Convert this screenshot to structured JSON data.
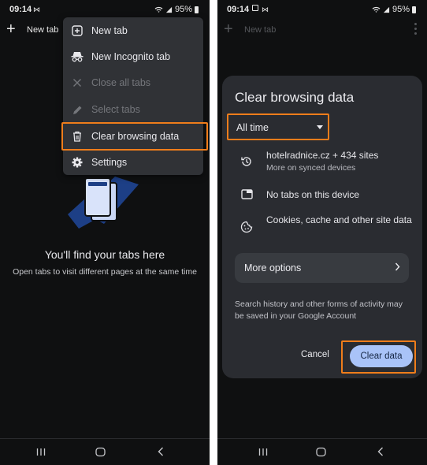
{
  "left_screen": {
    "status_bar": {
      "time": "09:14",
      "battery": "95%"
    },
    "toolbar": {
      "new_tab_label": "New tab"
    },
    "menu": {
      "items": [
        {
          "label": "New tab",
          "icon": "plus-box-icon",
          "enabled": true
        },
        {
          "label": "New Incognito tab",
          "icon": "incognito-icon",
          "enabled": true
        },
        {
          "label": "Close all tabs",
          "icon": "close-icon",
          "enabled": false
        },
        {
          "label": "Select tabs",
          "icon": "pencil-icon",
          "enabled": false
        },
        {
          "label": "Clear browsing data",
          "icon": "trash-icon",
          "enabled": true,
          "highlighted": true
        },
        {
          "label": "Settings",
          "icon": "gear-icon",
          "enabled": true
        }
      ]
    },
    "empty_state": {
      "title": "You'll find your tabs here",
      "subtitle": "Open tabs to visit different pages at the same time"
    }
  },
  "right_screen": {
    "status_bar": {
      "time": "09:14",
      "battery": "95%"
    },
    "toolbar": {
      "new_tab_label": "New tab"
    },
    "dialog": {
      "title": "Clear browsing data",
      "time_range": {
        "selected": "All time",
        "highlighted": true
      },
      "rows": [
        {
          "icon": "history-icon",
          "text": "hotelradnice.cz + 434 sites",
          "sub": "More on synced devices"
        },
        {
          "icon": "tab-icon",
          "text": "No tabs on this device",
          "sub": ""
        },
        {
          "icon": "cookie-icon",
          "text": "Cookies, cache and other site data",
          "sub": ""
        }
      ],
      "more_options_label": "More options",
      "note": "Search history and other forms of activity may be saved in your Google Account",
      "cancel_label": "Cancel",
      "clear_label": "Clear data"
    }
  },
  "colors": {
    "background": "#0f1011",
    "menu_bg": "#303236",
    "dialog_bg": "#2a2c31",
    "highlight": "#ef7d1b",
    "primary_button": "#a9c3f8",
    "illustration": "#1d3f86"
  }
}
